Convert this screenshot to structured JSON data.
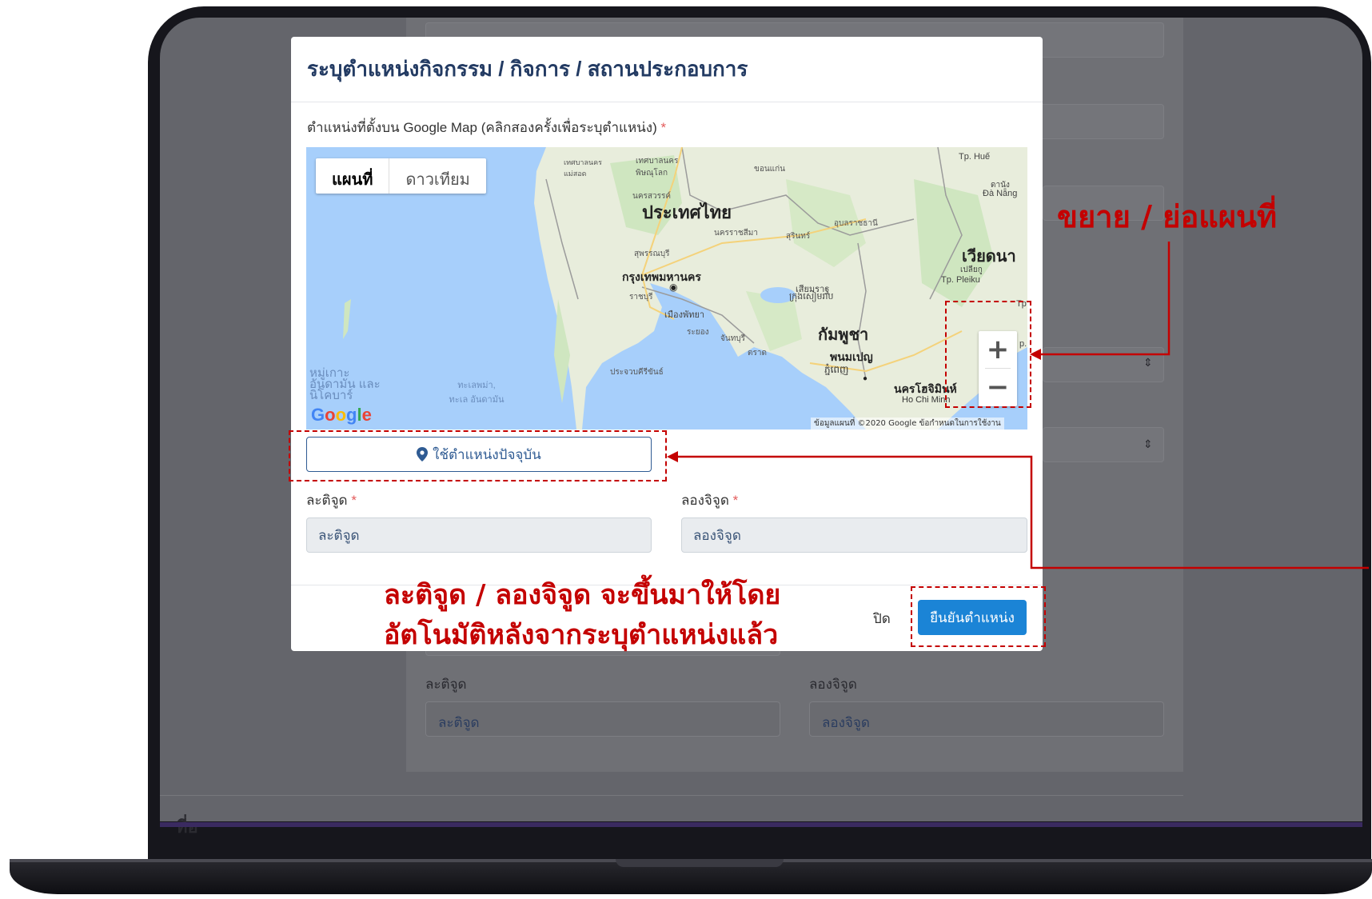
{
  "modal": {
    "title": "ระบุตำแหน่งกิจกรรม / กิจการ / สถานประกอบการ",
    "map_label": "ตำแหน่งที่ตั้งบน Google Map (คลิกสองครั้งเพื่อระบุตำแหน่ง)",
    "required_mark": "*",
    "map": {
      "type_toggle": [
        "แผนที่",
        "ดาวเทียม"
      ],
      "zoom_in": "+",
      "zoom_out": "−",
      "logo": "Google",
      "attribution": "ข้อมูลแผนที่ ©2020 Google   ข้อกำหนดในการใช้งาน",
      "labels": {
        "thailand": "ประเทศไทย",
        "bangkok": "กรุงเทพมหานคร",
        "cambodia": "กัมพูชา",
        "vietnam": "เวียดนา",
        "phnom_penh": "พนมเปญ",
        "phnom_penh_km": "ភ្នំពេញ",
        "hcmc": "นครโฮจิมินห์",
        "hcmc_en": "Ho Chi Minh",
        "siem_reap": "เสียมราฐ",
        "siem_reap_km": "ក្រុងសៀមរាប",
        "pattaya": "เมืองพัทยา",
        "rayong": "ระยอง",
        "chanthaburi": "จันทบุรี",
        "trat": "ตราด",
        "ratchaburi": "ราชบุรี",
        "suphanburi": "สุพรรณบุรี",
        "nakhon_sawan": "นครสวรรค์",
        "nakhon_ratchasima": "นครราชสีมา",
        "surin": "สุรินทร์",
        "ubon": "อุบลราชธานี",
        "khon_kaen": "ขอนแก่น",
        "phitsanulok": "เทศบาลนคร พิษณุโลก",
        "phetchabun": "เทศบาลนคร แม่สอด",
        "prachuap": "ประจวบคีรีขันธ์",
        "andaman_islands": "หมู่เกาะ อันดามัน และนิโคบาร์",
        "andaman_sea": "ทะเลพม่า, ทะเล อันดามัน",
        "pleiku_th": "เปลียกู",
        "pleiku": "Tp. Pleiku",
        "hue": "Tp. Huế",
        "danang_th": "ดานัง",
        "danang": "Đà Nẵng",
        "tp": "Tp",
        "p": "p."
      }
    },
    "use_location_button": "ใช้ตำแหน่งปัจจุบัน",
    "lat_label": "ละติจูด",
    "lng_label": "ลองจิจูด",
    "lat_value": "ละติจูด",
    "lng_value": "ลองจิจูด",
    "close_button": "ปิด",
    "confirm_button": "ยืนยันตำแหน่ง"
  },
  "background_form": {
    "lat_label": "ละติจูด",
    "lng_label": "ลองจิจูด",
    "lat_value": "ละติจูด",
    "lng_value": "ลองจิจูด",
    "bottom_cut_text": "ที่อ"
  },
  "annotations": {
    "zoom": "ขยาย / ย่อแผนที่",
    "latlng_line1": "ละติจูด / ลองจิจูด จะขึ้นมาให้โดย",
    "latlng_line2": "อัตโนมัติหลังจากระบุตำแหน่งแล้ว"
  },
  "colors": {
    "accent": "#1b84d6",
    "title": "#233b63",
    "annotation": "#c40000",
    "map_water": "#a7cffb",
    "map_land": "#e8eddc"
  }
}
